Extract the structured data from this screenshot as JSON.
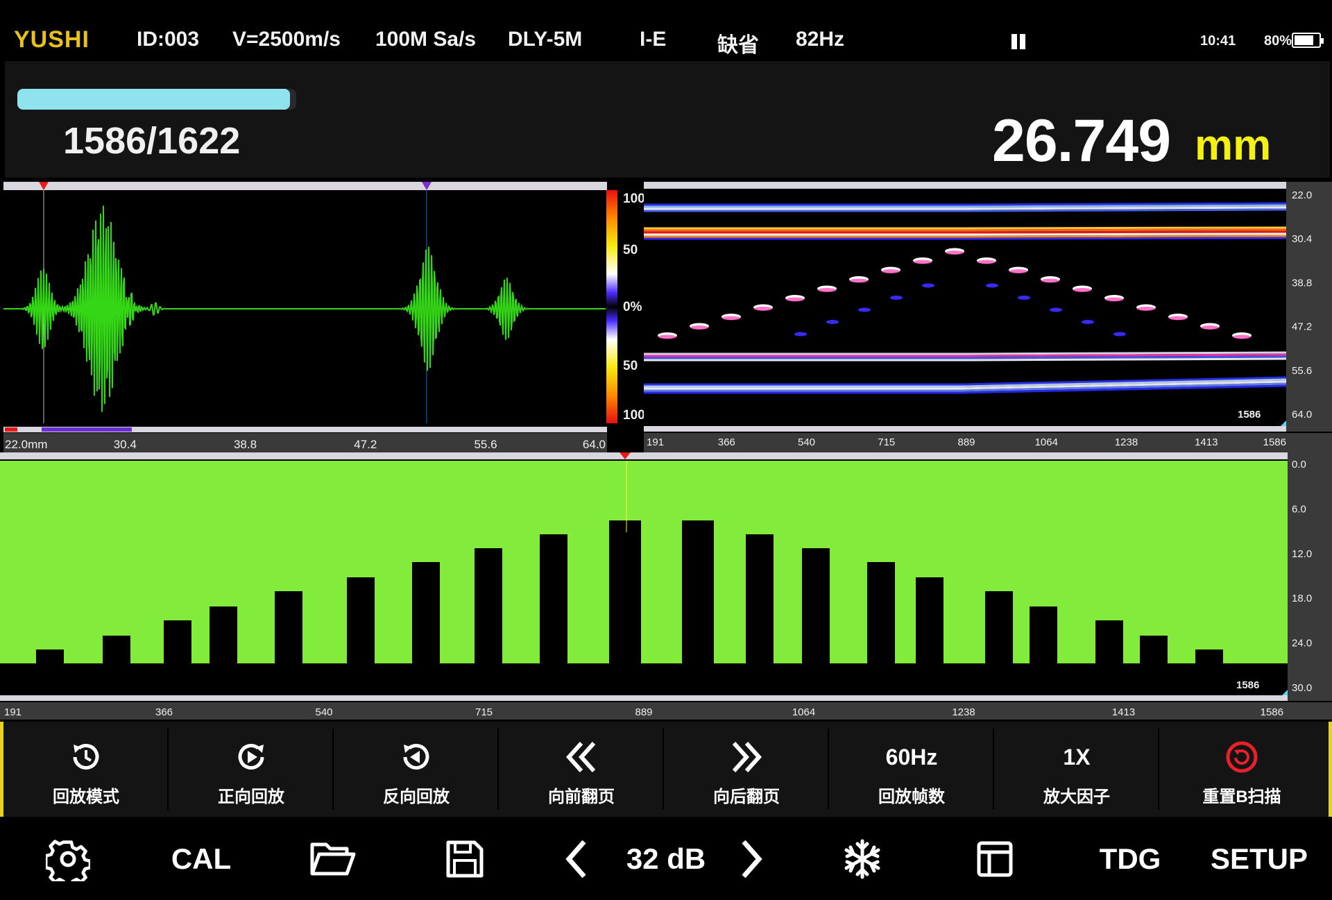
{
  "status_bar": {
    "brand": "YUSHI",
    "probe_id": "ID:003",
    "velocity": "V=2500m/s",
    "sample_rate": "100M Sa/s",
    "delay_line": "DLY-5M",
    "mode": "I-E",
    "preset": "缺省",
    "prf": "82Hz",
    "clock": "10:41",
    "battery": "80%",
    "battery_level": 0.8
  },
  "header": {
    "frame_counter": "1586/1622",
    "progress": 0.978,
    "thickness_value": "26.749",
    "thickness_unit": "mm"
  },
  "ascan": {
    "x_labels": [
      "22.0mm",
      "30.4",
      "38.8",
      "47.2",
      "55.6",
      "64.0"
    ]
  },
  "colorbar": {
    "labels": [
      "100",
      "50",
      "0%",
      "50",
      "100"
    ]
  },
  "bscan": {
    "x_labels": [
      "191",
      "366",
      "540",
      "715",
      "889",
      "1064",
      "1238",
      "1413",
      "1586"
    ],
    "y_labels": [
      "22.0",
      "30.4",
      "38.8",
      "47.2",
      "55.6",
      "64.0"
    ],
    "frame_tag": "1586"
  },
  "thickness_map": {
    "x_labels": [
      "191",
      "366",
      "540",
      "715",
      "889",
      "1064",
      "1238",
      "1413",
      "1586"
    ],
    "y_labels": [
      "0.0",
      "6.0",
      "12.0",
      "18.0",
      "24.0",
      "30.0"
    ],
    "frame_tag": "1586"
  },
  "softkeys": [
    {
      "label": "回放模式",
      "icon": "clock-history-icon"
    },
    {
      "label": "正向回放",
      "icon": "play-forward-icon"
    },
    {
      "label": "反向回放",
      "icon": "play-reverse-icon"
    },
    {
      "label": "向前翻页",
      "icon": "double-chevron-left-icon"
    },
    {
      "label": "向后翻页",
      "icon": "double-chevron-right-icon"
    },
    {
      "label": "回放帧数",
      "value": "60Hz"
    },
    {
      "label": "放大因子",
      "value": "1X"
    },
    {
      "label": "重置B扫描",
      "icon": "reset-icon",
      "accent": "#e8202a"
    }
  ],
  "toolbar": {
    "cal_label": "CAL",
    "gain_value": "32 dB",
    "tdg_label": "TDG",
    "setup_label": "SETUP"
  },
  "colors": {
    "brand": "#e8c21a",
    "unit": "#f3f014",
    "waveform": "#35d616",
    "map_fill": "#82eb3c",
    "progress": "#8fe3ee",
    "accent_bar": "#e8d21c"
  }
}
